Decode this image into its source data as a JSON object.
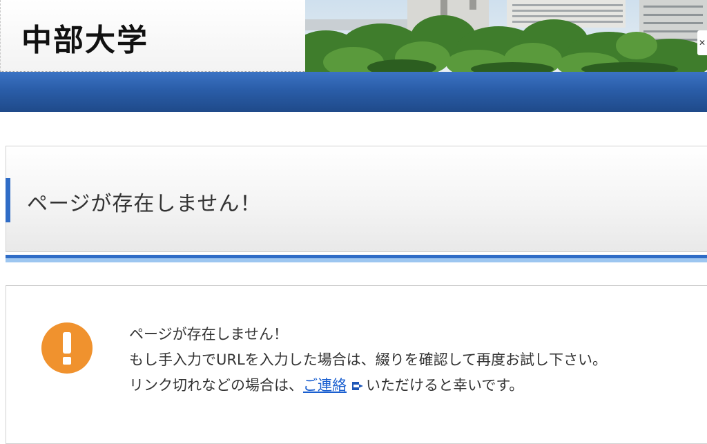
{
  "header": {
    "logo_text": "中部大学"
  },
  "title": {
    "heading": "ページが存在しません！"
  },
  "message": {
    "line1": "ページが存在しません！",
    "line2": "もし手入力でURLを入力した場合は、綴りを確認して再度お試し下さい。",
    "line3_prefix": "リンク切れなどの場合は、",
    "contact_link": "ご連絡",
    "line3_suffix": "いただけると幸いです。"
  },
  "icons": {
    "warning": "exclamation-circle-icon",
    "external_link": "arrow-right-icon"
  },
  "colors": {
    "navbar": "#2a5da8",
    "accent": "#2f6cc6",
    "warning": "#f0922e",
    "link": "#1a5fd0"
  }
}
